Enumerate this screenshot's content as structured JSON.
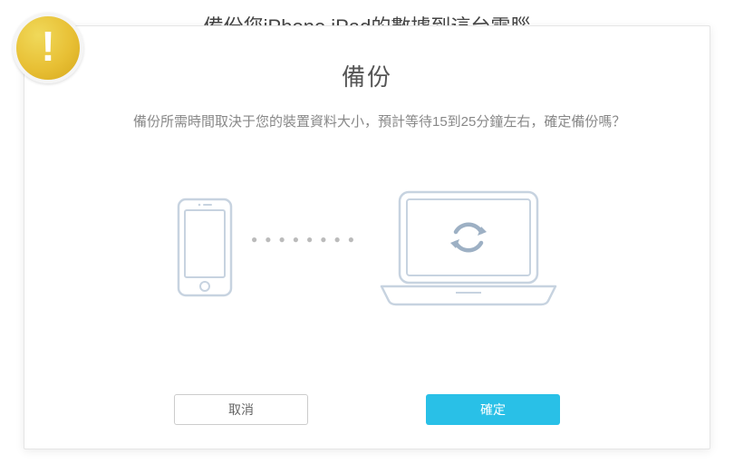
{
  "page": {
    "title": "備份您iPhone iPad的數據到這台電腦"
  },
  "dialog": {
    "title": "備份",
    "message": "備份所需時間取決于您的裝置資料大小，預計等待15到25分鐘左右，確定備份嗎？",
    "cancel_label": "取消",
    "confirm_label": "確定"
  },
  "colors": {
    "accent": "#29c0e7",
    "warning": "#e8c035"
  }
}
